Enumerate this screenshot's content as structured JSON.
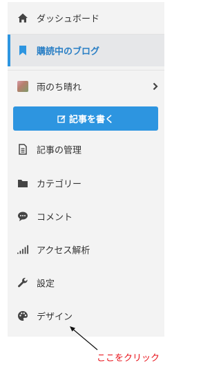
{
  "colors": {
    "accent": "#2d95e0",
    "active_text": "#2a7fc5",
    "icon": "#444444",
    "annotation": "#e8141c"
  },
  "sidebar": {
    "items": [
      {
        "label": "ダッシュボード",
        "icon": "home-icon"
      },
      {
        "label": "購読中のブログ",
        "icon": "bookmark-icon",
        "active": true
      },
      {
        "label": "雨のち晴れ",
        "icon": "avatar",
        "has_chevron": true
      }
    ],
    "write_button": {
      "label": "記事を書く",
      "icon": "edit-icon"
    },
    "menu": [
      {
        "label": "記事の管理",
        "icon": "document-icon"
      },
      {
        "label": "カテゴリー",
        "icon": "folder-icon"
      },
      {
        "label": "コメント",
        "icon": "comment-icon"
      },
      {
        "label": "アクセス解析",
        "icon": "signal-bars-icon"
      },
      {
        "label": "設定",
        "icon": "wrench-icon"
      },
      {
        "label": "デザイン",
        "icon": "palette-icon"
      }
    ]
  },
  "annotation": {
    "text": "ここをクリック"
  }
}
